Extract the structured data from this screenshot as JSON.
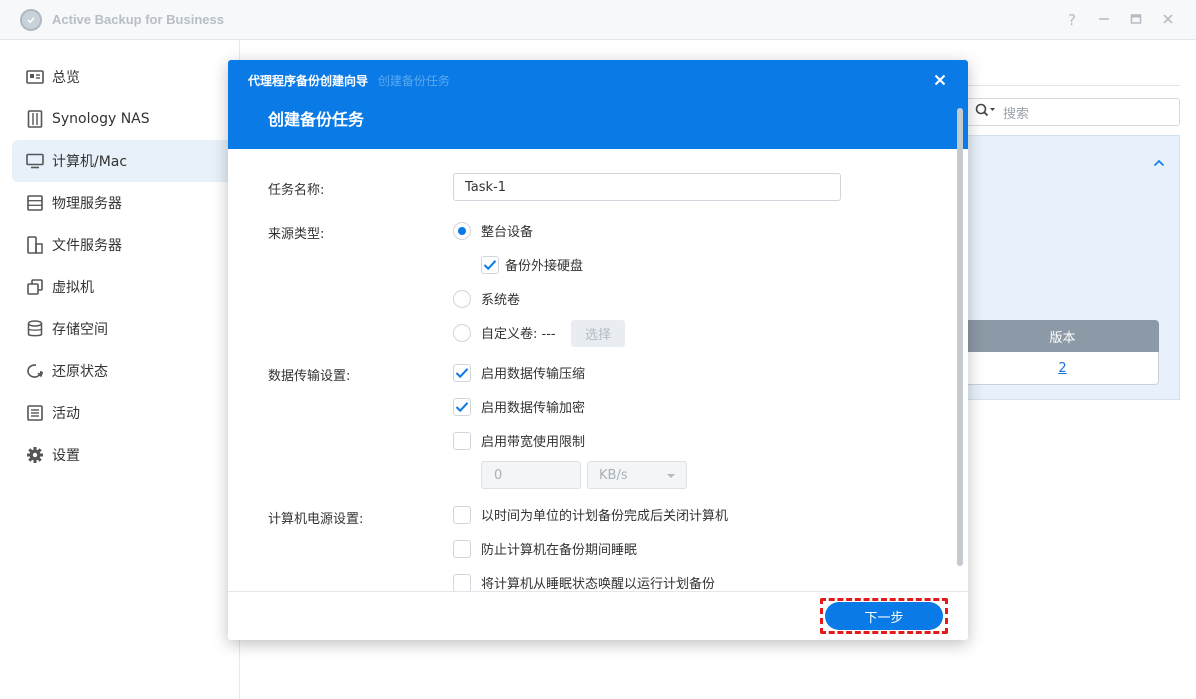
{
  "app": {
    "title": "Active Backup for Business"
  },
  "window_controls": {
    "help": "?",
    "minimize": "—",
    "maximize": "□",
    "close": "✕"
  },
  "sidebar": {
    "items": [
      {
        "label": "总览",
        "icon": "overview-icon",
        "active": false
      },
      {
        "label": "Synology NAS",
        "icon": "nas-icon",
        "active": false
      },
      {
        "label": "计算机/Mac",
        "icon": "computer-icon",
        "active": true
      },
      {
        "label": "物理服务器",
        "icon": "server-icon",
        "active": false
      },
      {
        "label": "文件服务器",
        "icon": "file-server-icon",
        "active": false
      },
      {
        "label": "虚拟机",
        "icon": "virtual-machine-icon",
        "active": false
      },
      {
        "label": "存储空间",
        "icon": "storage-icon",
        "active": false
      },
      {
        "label": "还原状态",
        "icon": "restore-icon",
        "active": false
      },
      {
        "label": "活动",
        "icon": "activity-icon",
        "active": false
      },
      {
        "label": "设置",
        "icon": "settings-icon",
        "active": false
      }
    ]
  },
  "background": {
    "search_placeholder": "搜索",
    "table_header": "版本",
    "table_value": "2"
  },
  "dialog": {
    "breadcrumb_1": "代理程序备份创建向导",
    "breadcrumb_2": "创建备份任务",
    "title": "创建备份任务",
    "fields": {
      "task_name_label": "任务名称:",
      "task_name_value": "Task-1",
      "source_type_label": "来源类型:",
      "source_options": {
        "entire_device": {
          "label": "整台设备",
          "checked": true
        },
        "backup_external": {
          "label": "备份外接硬盘",
          "checked": true
        },
        "system_volume": {
          "label": "系统卷",
          "checked": false
        },
        "custom_volume": {
          "label": "自定义卷: ---",
          "checked": false
        },
        "select_button": "选择"
      },
      "transfer_label": "数据传输设置:",
      "transfer_options": {
        "compression": {
          "label": "启用数据传输压缩",
          "checked": true
        },
        "encryption": {
          "label": "启用数据传输加密",
          "checked": true
        },
        "bandwidth": {
          "label": "启用带宽使用限制",
          "checked": false
        },
        "bandwidth_value": "0",
        "bandwidth_unit": "KB/s"
      },
      "power_label": "计算机电源设置:",
      "power_options": {
        "shutdown": {
          "label": "以时间为单位的计划备份完成后关闭计算机",
          "checked": false
        },
        "prevent_sleep": {
          "label": "防止计算机在备份期间睡眠",
          "checked": false
        },
        "wake": {
          "label": "将计算机从睡眠状态唤醒以运行计划备份",
          "checked": false
        }
      }
    },
    "next_button": "下一步"
  },
  "colors": {
    "accent": "#0a7ae6",
    "highlight": "#e41b1b",
    "sidebar_active": "#e8f0f9"
  }
}
